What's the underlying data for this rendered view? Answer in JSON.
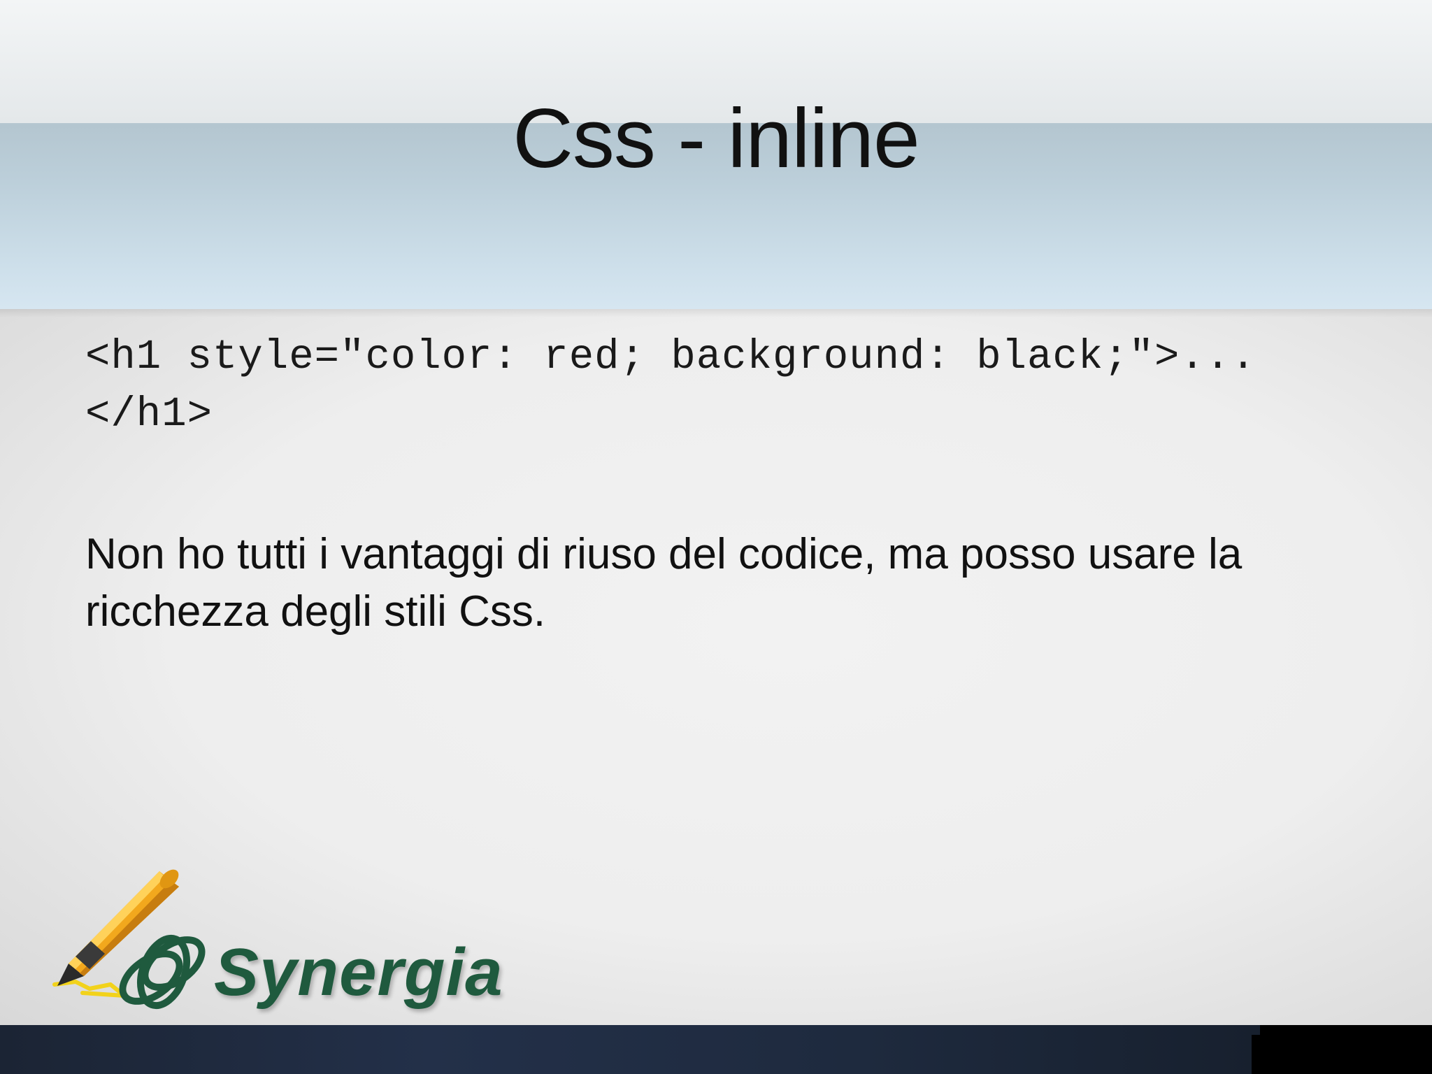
{
  "slide": {
    "title": "Css - inline",
    "code": "<h1 style=\"color: red; background: black;\">...</h1>",
    "body": "Non ho tutti i vantaggi di riuso del codice, ma posso usare la ricchezza degli stili Css."
  },
  "logo": {
    "text": "Synergia",
    "icon": "highlighter-pen-icon",
    "brand_color": "#1f5a3e",
    "pen_color": "#f2a81d"
  }
}
